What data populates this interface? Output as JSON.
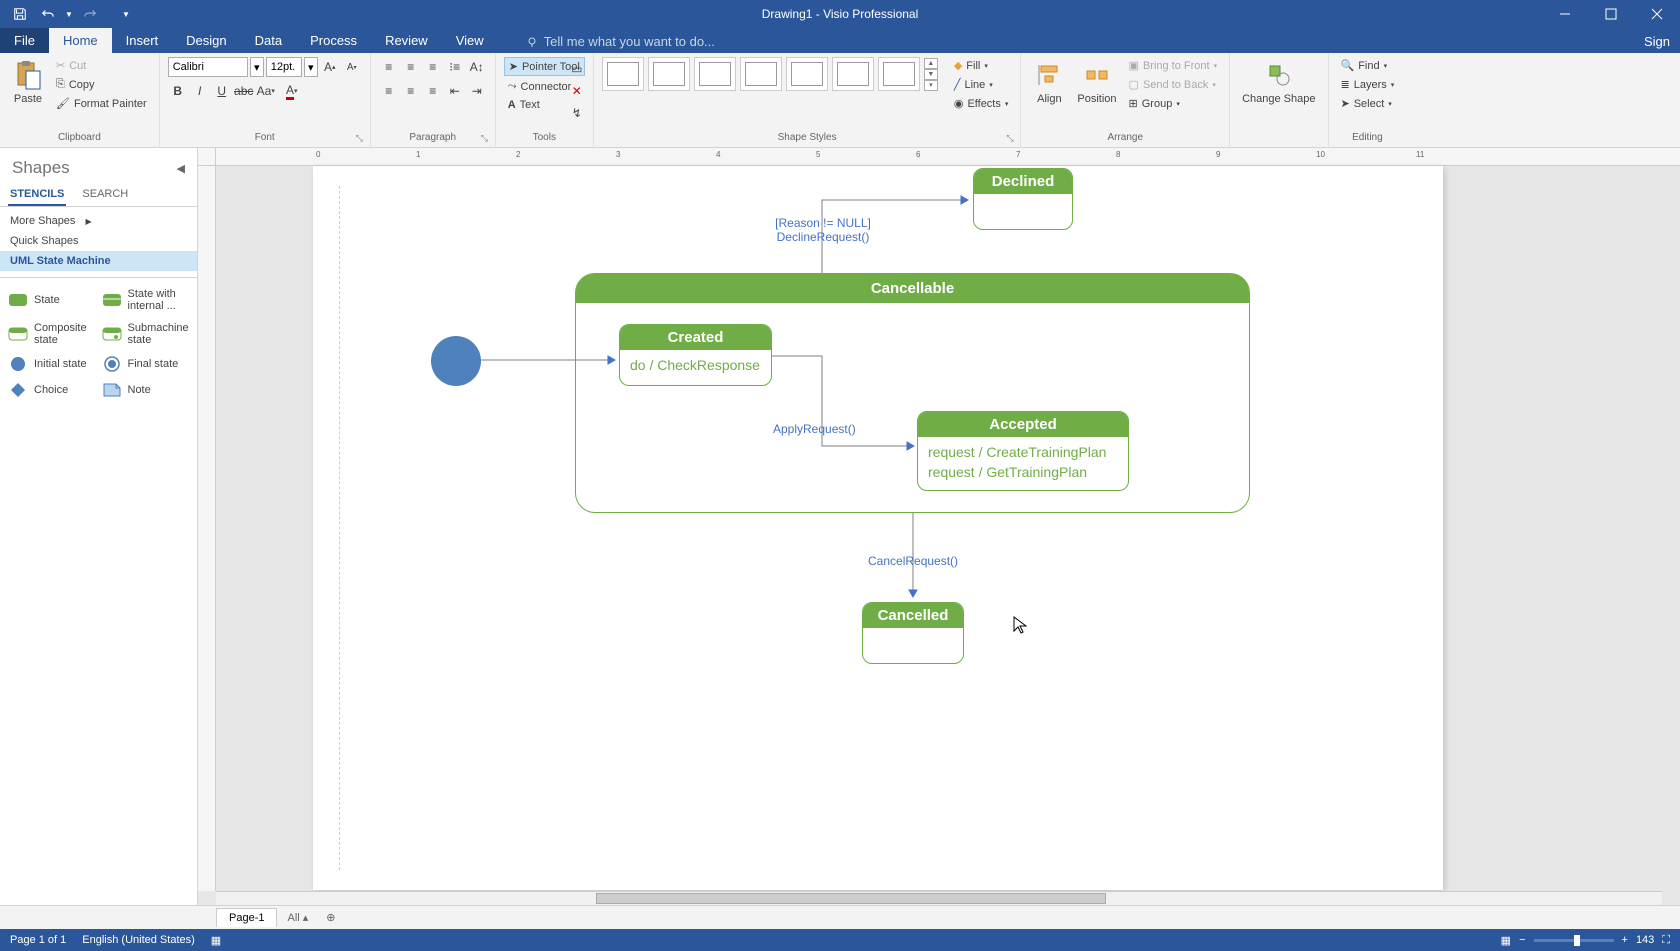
{
  "app": {
    "title": "Drawing1 - Visio Professional",
    "signin": "Sign"
  },
  "menu": {
    "file": "File",
    "tabs": [
      "Home",
      "Insert",
      "Design",
      "Data",
      "Process",
      "Review",
      "View"
    ],
    "active": "Home",
    "tellme": "Tell me what you want to do..."
  },
  "ribbon": {
    "clipboard": {
      "label": "Clipboard",
      "paste": "Paste",
      "cut": "Cut",
      "copy": "Copy",
      "format_painter": "Format Painter"
    },
    "font": {
      "label": "Font",
      "name": "Calibri",
      "size": "12pt."
    },
    "paragraph": {
      "label": "Paragraph"
    },
    "tools": {
      "label": "Tools",
      "pointer": "Pointer Tool",
      "connector": "Connector",
      "text": "Text"
    },
    "shape_styles": {
      "label": "Shape Styles",
      "fill": "Fill",
      "line": "Line",
      "effects": "Effects"
    },
    "arrange": {
      "label": "Arrange",
      "align": "Align",
      "position": "Position",
      "bring_front": "Bring to Front",
      "send_back": "Send to Back",
      "group": "Group"
    },
    "change_shape": "Change Shape",
    "editing": {
      "label": "Editing",
      "find": "Find",
      "layers": "Layers",
      "select": "Select"
    }
  },
  "shapes_panel": {
    "title": "Shapes",
    "tabs": {
      "stencils": "STENCILS",
      "search": "SEARCH"
    },
    "more_shapes": "More Shapes",
    "quick_shapes": "Quick Shapes",
    "current_stencil": "UML State Machine",
    "shapes": {
      "state": "State",
      "state_internal": "State with internal ...",
      "composite": "Composite state",
      "submachine": "Submachine state",
      "initial": "Initial state",
      "final": "Final state",
      "choice": "Choice",
      "note": "Note"
    }
  },
  "diagram": {
    "declined": "Declined",
    "decline_guard": "[Reason != NULL]",
    "decline_action": "DeclineRequest()",
    "cancellable": "Cancellable",
    "created": "Created",
    "created_do": "do / CheckResponse",
    "apply": "ApplyRequest()",
    "accepted": "Accepted",
    "accepted_l1": "request / CreateTrainingPlan",
    "accepted_l2": "request / GetTrainingPlan",
    "cancel_req": "CancelRequest()",
    "cancelled": "Cancelled"
  },
  "page_tabs": {
    "page1": "Page-1",
    "all": "All"
  },
  "status": {
    "page": "Page 1 of 1",
    "lang": "English (United States)",
    "zoom": "143"
  },
  "ruler_h": [
    "0",
    "1",
    "2",
    "3",
    "4",
    "5",
    "6",
    "7",
    "8",
    "9",
    "10",
    "11"
  ],
  "chart_data": {
    "type": "state-machine",
    "initial": "Initial",
    "states": [
      {
        "name": "Declined"
      },
      {
        "name": "Cancellable",
        "composite": true,
        "children": [
          "Created",
          "Accepted"
        ]
      },
      {
        "name": "Created",
        "internal": [
          "do / CheckResponse"
        ]
      },
      {
        "name": "Accepted",
        "internal": [
          "request / CreateTrainingPlan",
          "request / GetTrainingPlan"
        ]
      },
      {
        "name": "Cancelled"
      }
    ],
    "transitions": [
      {
        "from": "Initial",
        "to": "Created"
      },
      {
        "from": "Created",
        "to": "Declined",
        "guard": "[Reason != NULL]",
        "action": "DeclineRequest()"
      },
      {
        "from": "Created",
        "to": "Accepted",
        "action": "ApplyRequest()"
      },
      {
        "from": "Cancellable",
        "to": "Cancelled",
        "action": "CancelRequest()"
      }
    ]
  }
}
